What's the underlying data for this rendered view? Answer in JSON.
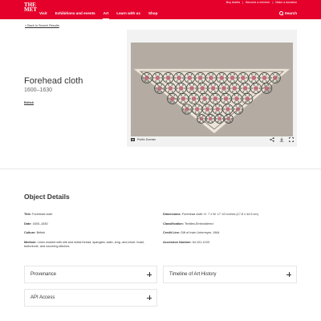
{
  "header": {
    "logo_line1": "THE",
    "logo_line2": "MET",
    "utility": [
      "Buy tickets",
      "Become a member",
      "Make a donation"
    ],
    "nav": [
      "Visit",
      "Exhibitions and events",
      "Art",
      "Learn with us",
      "Shop"
    ],
    "active_nav": "Art",
    "search_label": "Search"
  },
  "back_link": "< Back to Search Results",
  "object": {
    "title": "Forehead cloth",
    "date": "1600–1630",
    "culture": "British"
  },
  "image": {
    "license": "Public Domain",
    "license_icon": "PD",
    "actions": [
      "share-icon",
      "download-icon",
      "fullscreen-icon"
    ],
    "background_color": "#b4aba2",
    "cloth_color": "#efe8dc"
  },
  "details": {
    "heading": "Object Details",
    "left": [
      {
        "label": "Title:",
        "value": "Forehead cloth"
      },
      {
        "label": "Date:",
        "value": "1600–1630"
      },
      {
        "label": "Culture:",
        "value": "British"
      },
      {
        "label": "Medium:",
        "value": "Linen worked with silk and metal thread, spangles; satin, long -and-short, braid, buttonhole, and couching stitches"
      }
    ],
    "right": [
      {
        "label": "Dimensions:",
        "value": "Forehead cloth: H. 7 x W. 17 1/2 inches (17.8 x 44.5 cm)"
      },
      {
        "label": "Classification:",
        "value": "Textiles-Embroidered"
      },
      {
        "label": "Credit Line:",
        "value": "Gift of Irwin Untermyer, 1964"
      },
      {
        "label": "Accession Number:",
        "value": "64.101.1243"
      }
    ]
  },
  "accordions": {
    "provenance": "Provenance",
    "timeline": "Timeline of Art History",
    "api": "API Access"
  },
  "colors": {
    "brand_red": "#e4002b"
  }
}
